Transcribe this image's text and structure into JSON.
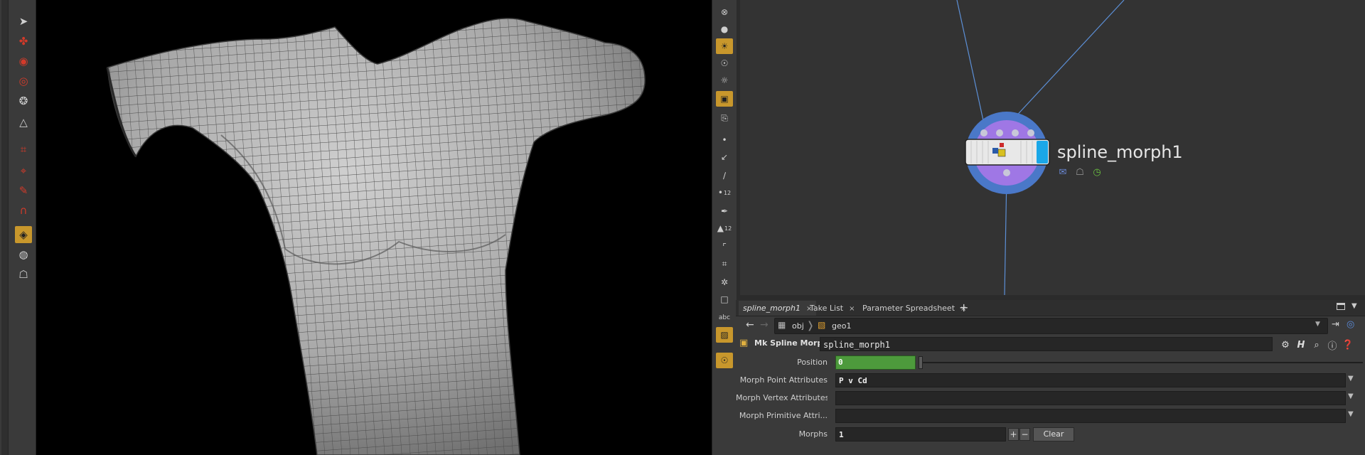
{
  "left_toolbar": {
    "icons": [
      "select-arrow-icon",
      "transform-icon",
      "scale-icon",
      "rotate-icon",
      "pose-icon",
      "handle-icon",
      "magnet-icon",
      "snap-icon",
      "edit-icon",
      "magnet-red-icon",
      "camera-active-icon",
      "render-region-icon",
      "viewport-display-icon"
    ]
  },
  "middle_toolbar": {
    "label_12a": "12",
    "label_12b": "12",
    "label_abc": "abc"
  },
  "network": {
    "node_name": "spline_morph1",
    "colors": {
      "bg": "#333333",
      "wire": "#5c8fd6",
      "ring": "#4a78c8",
      "ring_inner": "#a877e8",
      "flag_blue": "#1aa7e8"
    }
  },
  "panel": {
    "tabs": [
      {
        "label": "spline_morph1",
        "close": "×"
      },
      {
        "label": "Take List",
        "close": "×"
      },
      {
        "label": "Parameter Spreadsheet",
        "close": "×"
      }
    ],
    "tab_add": "+",
    "path": {
      "crumb1": "obj",
      "crumb2": "geo1"
    },
    "node_type": "Mk Spline Morph",
    "node_name_value": "spline_morph1",
    "params": {
      "position": {
        "label": "Position",
        "value": "0",
        "fraction": 0.0
      },
      "morph_point_attrs": {
        "label": "Morph Point Attributes",
        "value": "P v Cd"
      },
      "morph_vertex_attrs": {
        "label": "Morph Vertex Attributes",
        "value": ""
      },
      "morph_primitive_attrs": {
        "label": "Morph Primitive Attri...",
        "value": ""
      },
      "morphs": {
        "label": "Morphs",
        "value": "1",
        "plus": "+",
        "minus": "−",
        "clear": "Clear"
      }
    }
  }
}
